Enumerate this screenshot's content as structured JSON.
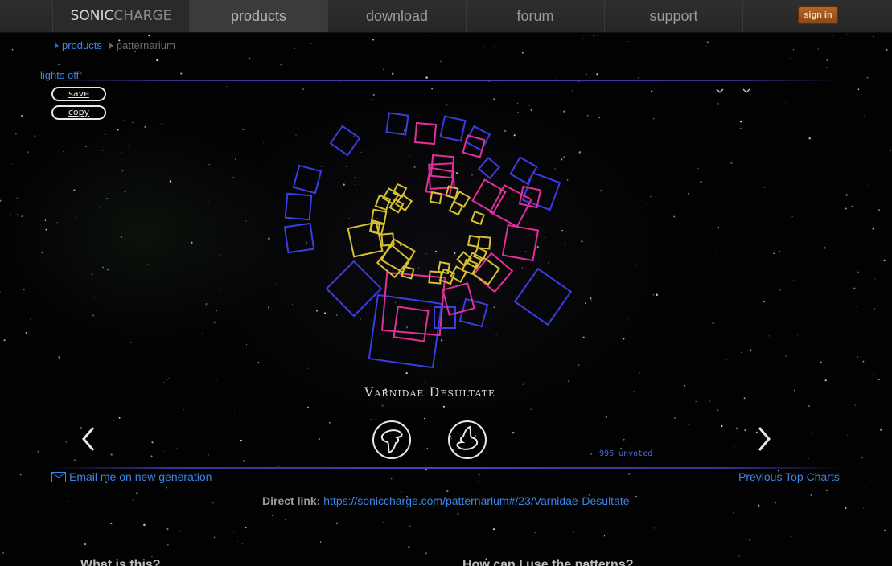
{
  "nav": {
    "logo_part1": "SONIC",
    "logo_part2": "CHARGE",
    "items": [
      {
        "label": "products"
      },
      {
        "label": "download"
      },
      {
        "label": "forum"
      },
      {
        "label": "support"
      }
    ],
    "sign_in": "sign in"
  },
  "breadcrumb": [
    "products",
    "patternarium"
  ],
  "lights_toggle": "lights off",
  "pattern_buttons": {
    "save": "save",
    "copy": "copy"
  },
  "pattern": {
    "name": "Varnidae Desultate",
    "unvoted_count": "996",
    "unvoted_label": "unvoted"
  },
  "links": {
    "email": "Email me on new generation",
    "previous_top": "Previous Top Charts",
    "direct_label": "Direct link:",
    "direct_url": "https://soniccharge.com/patternarium#/23/Varnidae-Desultate"
  },
  "faq": {
    "what": "What is this?",
    "how": "How can I use the patterns?"
  },
  "colors": {
    "link": "#3c86e6",
    "accent_signin": "#a6561f",
    "square_blue": "#3a3de0",
    "square_magenta": "#e0309a",
    "square_yellow": "#d8c030"
  },
  "icons": [
    "chevron-down-icon",
    "chevron-left-icon",
    "chevron-right-icon",
    "thumbs-down-icon",
    "thumbs-up-icon",
    "envelope-icon"
  ]
}
